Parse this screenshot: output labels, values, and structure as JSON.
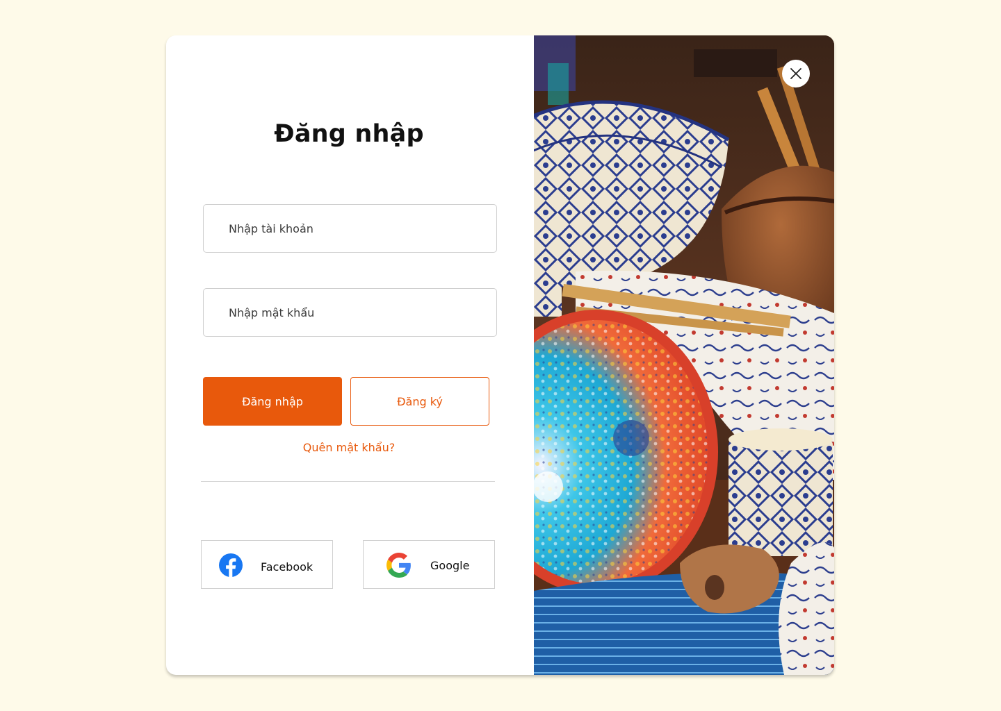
{
  "login": {
    "title": "Đăng nhập",
    "username_placeholder": "Nhập tài khoản",
    "password_placeholder": "Nhập mật khẩu",
    "login_label": "Đăng nhập",
    "register_label": "Đăng ký",
    "forgot_label": "Quên mật khẩu?"
  },
  "social": {
    "facebook_label": "Facebook",
    "google_label": "Google"
  },
  "icons": {
    "close": "close-icon",
    "facebook": "facebook-icon",
    "google": "google-icon"
  },
  "colors": {
    "background": "#fefae9",
    "accent": "#e8590c",
    "facebook": "#1877f2"
  }
}
